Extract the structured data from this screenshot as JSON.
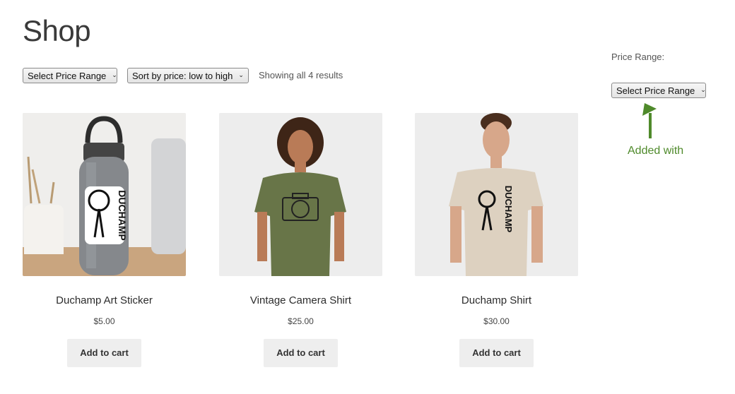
{
  "page": {
    "title": "Shop"
  },
  "toolbar": {
    "price_range_select": "Select Price Range",
    "sort_select": "Sort by price: low to high",
    "result_count": "Showing all 4 results"
  },
  "sidebar": {
    "widget_title": "Price Range:",
    "price_range_select": "Select Price Range",
    "annotation": "Added with"
  },
  "products": [
    {
      "name": "Duchamp Art Sticker",
      "price": "$5.00",
      "cta": "Add to cart",
      "image": "water-bottle-sticker"
    },
    {
      "name": "Vintage Camera Shirt",
      "price": "$25.00",
      "cta": "Add to cart",
      "image": "camera-shirt"
    },
    {
      "name": "Duchamp Shirt",
      "price": "$30.00",
      "cta": "Add to cart",
      "image": "duchamp-shirt"
    }
  ],
  "colors": {
    "annotation_green": "#4f8a2b",
    "button_bg": "#eeeeee"
  },
  "icons": {
    "select_chevron": "chevron-down-icon",
    "arrow": "arrow-up-icon"
  }
}
